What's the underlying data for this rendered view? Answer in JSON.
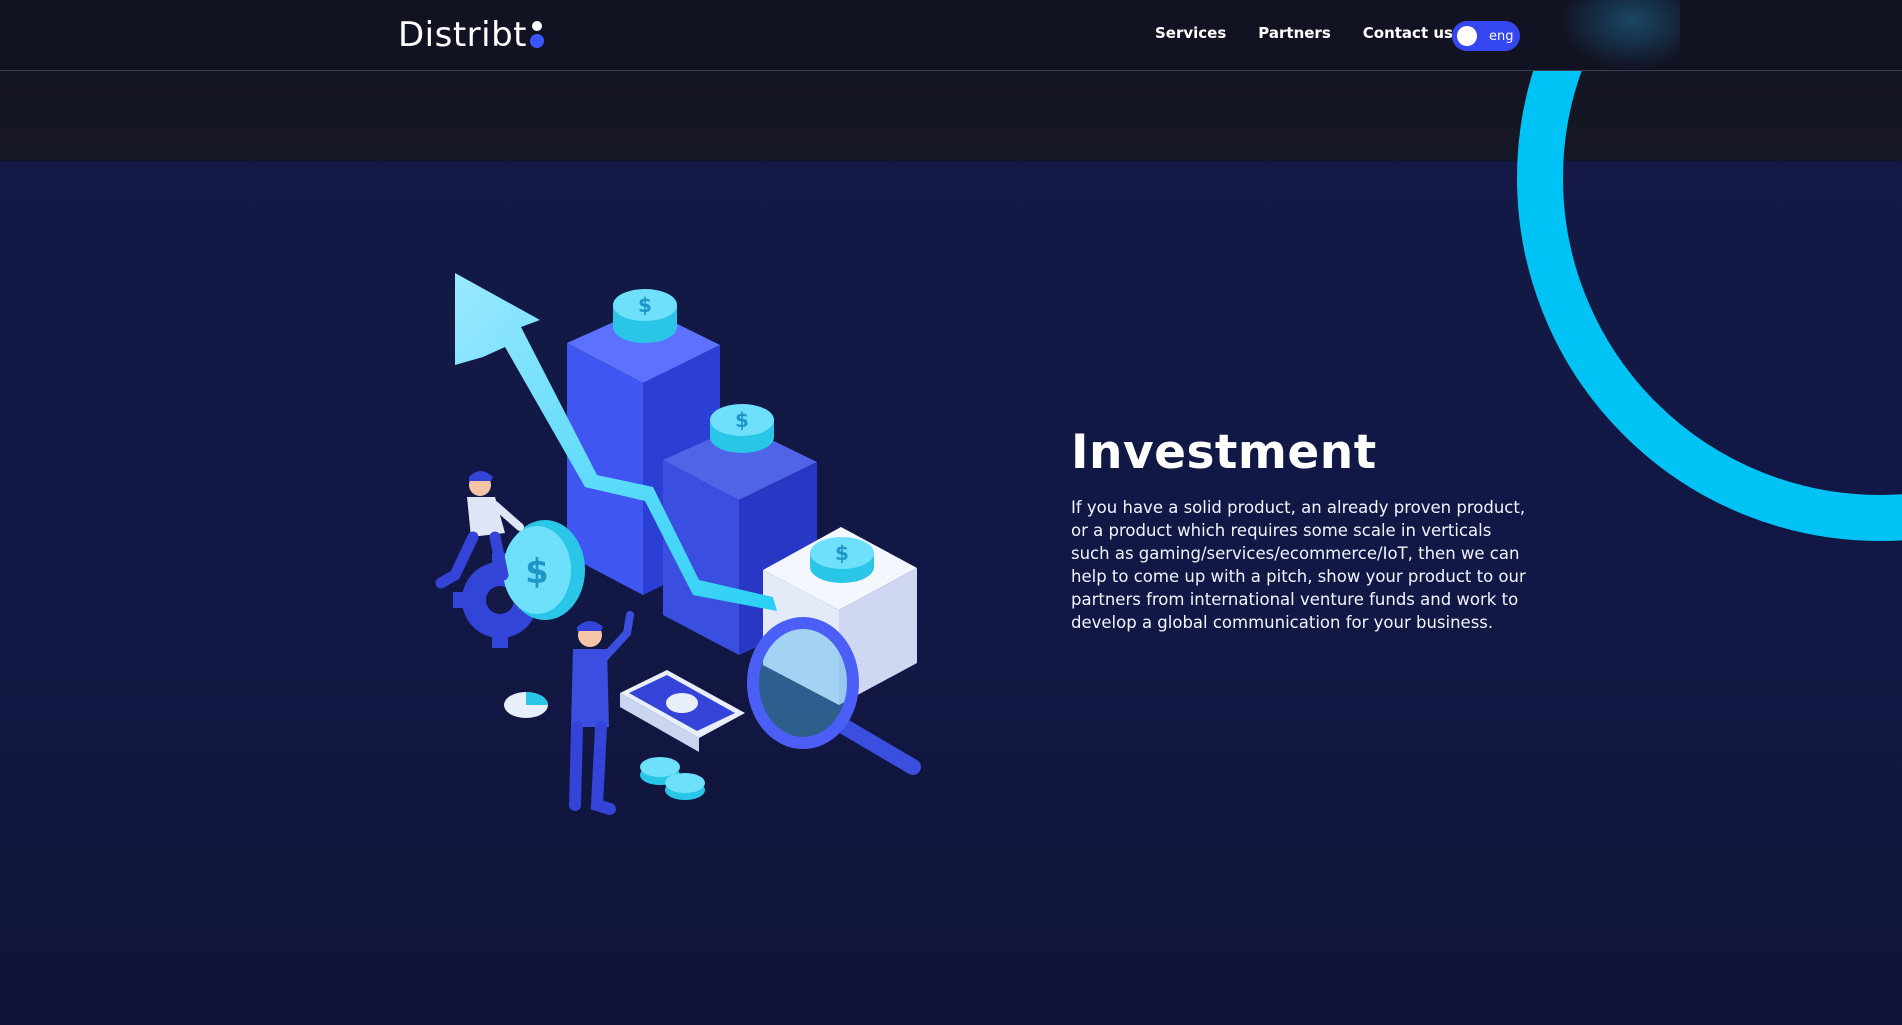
{
  "brand": {
    "name": "Distribt"
  },
  "nav": {
    "items": [
      {
        "label": "Services"
      },
      {
        "label": "Partners"
      },
      {
        "label": "Contact us"
      }
    ],
    "language": {
      "label": "eng",
      "enabled": true
    }
  },
  "section": {
    "title": "Investment",
    "description": "If you have a solid product, an already proven product, or a product which requires some scale in verticals such as gaming/services/ecommerce/IoT, then we can help to come up with a pitch, show your product to our partners from international venture funds and work to develop a global communication for your business.",
    "illustration": {
      "coin_symbol": "$"
    }
  },
  "colors": {
    "background": "#141a45",
    "navbar": "#121322",
    "accent_blue": "#3447f0",
    "ring_cyan": "#00c3f5"
  }
}
